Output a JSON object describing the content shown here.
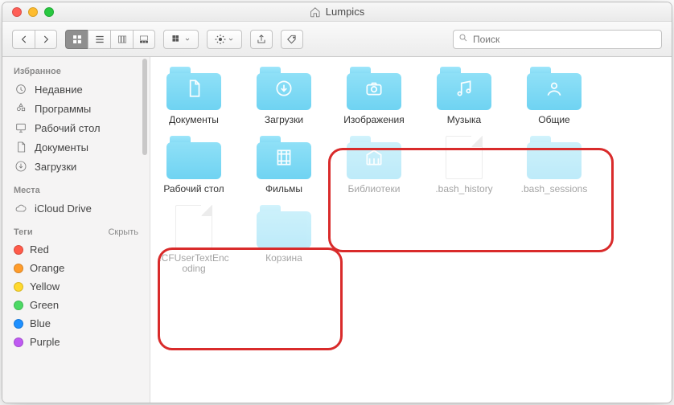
{
  "window": {
    "title": "Lumpics"
  },
  "toolbar": {
    "search_placeholder": "Поиск"
  },
  "sidebar": {
    "sections": {
      "favorites": {
        "title": "Избранное",
        "items": [
          {
            "label": "Недавние",
            "icon": "clock-icon"
          },
          {
            "label": "Программы",
            "icon": "apps-icon"
          },
          {
            "label": "Рабочий стол",
            "icon": "desktop-icon"
          },
          {
            "label": "Документы",
            "icon": "documents-icon"
          },
          {
            "label": "Загрузки",
            "icon": "downloads-icon"
          }
        ]
      },
      "locations": {
        "title": "Места",
        "items": [
          {
            "label": "iCloud Drive",
            "icon": "cloud-icon"
          }
        ]
      },
      "tags": {
        "title": "Теги",
        "action": "Скрыть",
        "items": [
          {
            "label": "Red",
            "color": "tag-red"
          },
          {
            "label": "Orange",
            "color": "tag-orange"
          },
          {
            "label": "Yellow",
            "color": "tag-yellow"
          },
          {
            "label": "Green",
            "color": "tag-green"
          },
          {
            "label": "Blue",
            "color": "tag-blue"
          },
          {
            "label": "Purple",
            "color": "tag-purple"
          }
        ]
      }
    }
  },
  "items": [
    {
      "name": "Документы",
      "type": "folder",
      "glyph": "doc",
      "hidden": false
    },
    {
      "name": "Загрузки",
      "type": "folder",
      "glyph": "down",
      "hidden": false
    },
    {
      "name": "Изображения",
      "type": "folder",
      "glyph": "camera",
      "hidden": false
    },
    {
      "name": "Музыка",
      "type": "folder",
      "glyph": "music",
      "hidden": false
    },
    {
      "name": "Общие",
      "type": "folder",
      "glyph": "user",
      "hidden": false
    },
    {
      "name": "Рабочий стол",
      "type": "folder",
      "glyph": "none",
      "hidden": false
    },
    {
      "name": "Фильмы",
      "type": "folder",
      "glyph": "film",
      "hidden": false
    },
    {
      "name": "Библиотеки",
      "type": "folder",
      "glyph": "library",
      "hidden": true
    },
    {
      "name": ".bash_history",
      "type": "file",
      "glyph": "none",
      "hidden": true
    },
    {
      "name": ".bash_sessions",
      "type": "folder",
      "glyph": "none",
      "hidden": true
    },
    {
      "name": ".CFUserTextEncoding",
      "type": "file",
      "glyph": "none",
      "hidden": true
    },
    {
      "name": "Корзина",
      "type": "folder",
      "glyph": "none",
      "hidden": true
    }
  ]
}
